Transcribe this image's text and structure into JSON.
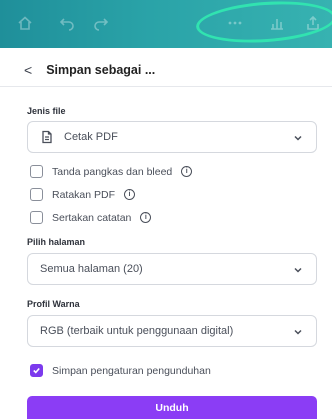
{
  "toolbar": {
    "icons": [
      "home-icon",
      "undo-icon",
      "redo-icon",
      "more-icon",
      "chart-icon",
      "share-icon"
    ]
  },
  "panel": {
    "back_glyph": "<",
    "title": "Simpan sebagai ..."
  },
  "file_type": {
    "label": "Jenis file",
    "value": "Cetak PDF",
    "icon": "document-icon"
  },
  "options": [
    {
      "label": "Tanda pangkas dan bleed",
      "checked": false,
      "info": true
    },
    {
      "label": "Ratakan PDF",
      "checked": false,
      "info": true
    },
    {
      "label": "Sertakan catatan",
      "checked": false,
      "info": true
    }
  ],
  "info_glyph": "i",
  "pages": {
    "label": "Pilih halaman",
    "value": "Semua halaman (20)"
  },
  "color_profile": {
    "label": "Profil Warna",
    "value": "RGB (terbaik untuk penggunaan digital)"
  },
  "save_settings": {
    "label": "Simpan pengaturan pengunduhan",
    "checked": true
  },
  "download_button": {
    "label": "Unduh"
  },
  "colors": {
    "toolbar": "#2aa3a8",
    "highlight": "#31e3b0",
    "accent": "#8b3df5"
  }
}
